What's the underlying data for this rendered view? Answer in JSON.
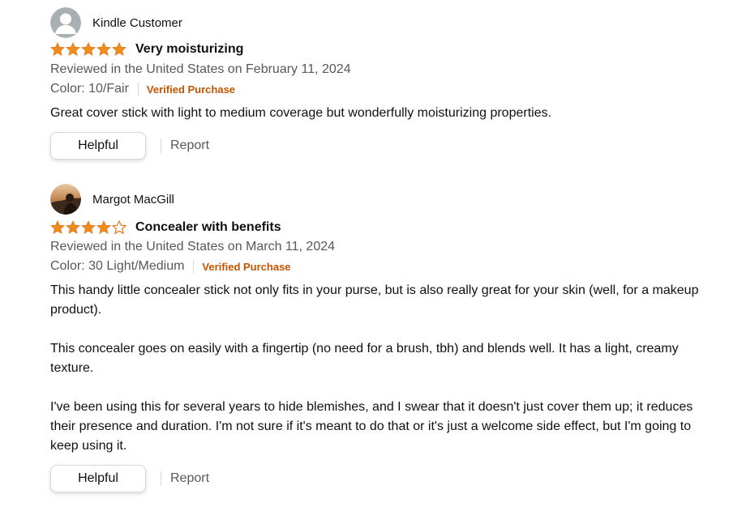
{
  "reviews": [
    {
      "author": "Kindle Customer",
      "avatar": "default-person-icon",
      "rating": 5,
      "title": "Very moisturizing",
      "date_line": "Reviewed in the United States on February 11, 2024",
      "variant": "Color: 10/Fair",
      "verified": "Verified Purchase",
      "body": [
        "Great cover stick with light to medium coverage but wonderfully moisturizing properties."
      ],
      "helpful_label": "Helpful",
      "report_label": "Report"
    },
    {
      "author": "Margot MacGill",
      "avatar": "user-photo",
      "rating": 4,
      "title": "Concealer with benefits",
      "date_line": "Reviewed in the United States on March 11, 2024",
      "variant": "Color: 30 Light/Medium",
      "verified": "Verified Purchase",
      "body": [
        "This handy little concealer stick not only fits in your purse, but is also really great for your skin (well, for a makeup product).",
        "This concealer goes on easily with a fingertip (no need for a brush, tbh) and blends well. It has a light, creamy texture.",
        "I've been using this for several years to hide blemishes, and I swear that it doesn't just cover them up; it reduces their presence and duration. I'm not sure if it's meant to do that or it's just a welcome side effect, but I'm going to keep using it."
      ],
      "helpful_label": "Helpful",
      "report_label": "Report"
    }
  ],
  "colors": {
    "star_fill": "#f08c1a",
    "star_outline": "#de7921",
    "verified": "#c45500",
    "meta_text": "#565959",
    "primary_text": "#0f1111"
  }
}
